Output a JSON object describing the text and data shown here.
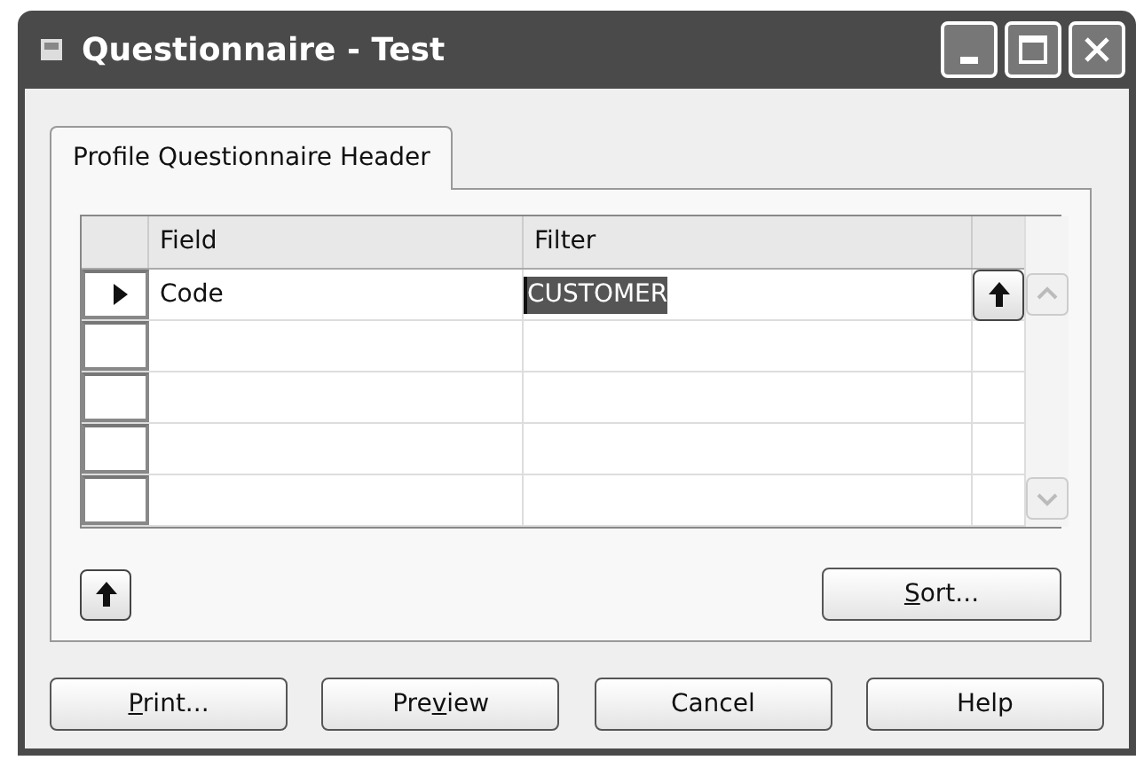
{
  "window": {
    "title": "Questionnaire - Test"
  },
  "tabs": [
    {
      "label": "Profile Questionnaire Header",
      "selected": true
    }
  ],
  "table": {
    "columns": [
      "Field",
      "Filter"
    ],
    "rows": [
      {
        "current": true,
        "field": "Code",
        "filter": "CUSTOMER",
        "filter_selected": true
      },
      {
        "current": false
      },
      {
        "current": false
      },
      {
        "current": false
      },
      {
        "current": false
      }
    ]
  },
  "sort_button": {
    "label": [
      {
        "text": "S",
        "access_key": true
      },
      {
        "text": "ort...",
        "access_key": false
      }
    ]
  },
  "buttons": [
    {
      "label": [
        {
          "text": "P",
          "access_key": true
        },
        {
          "text": "rint...",
          "access_key": false
        }
      ]
    },
    {
      "label": [
        {
          "text": "Pre",
          "access_key": false
        },
        {
          "text": "v",
          "access_key": true
        },
        {
          "text": "iew",
          "access_key": false
        }
      ]
    },
    {
      "label": "Cancel"
    },
    {
      "label": "Help"
    }
  ]
}
